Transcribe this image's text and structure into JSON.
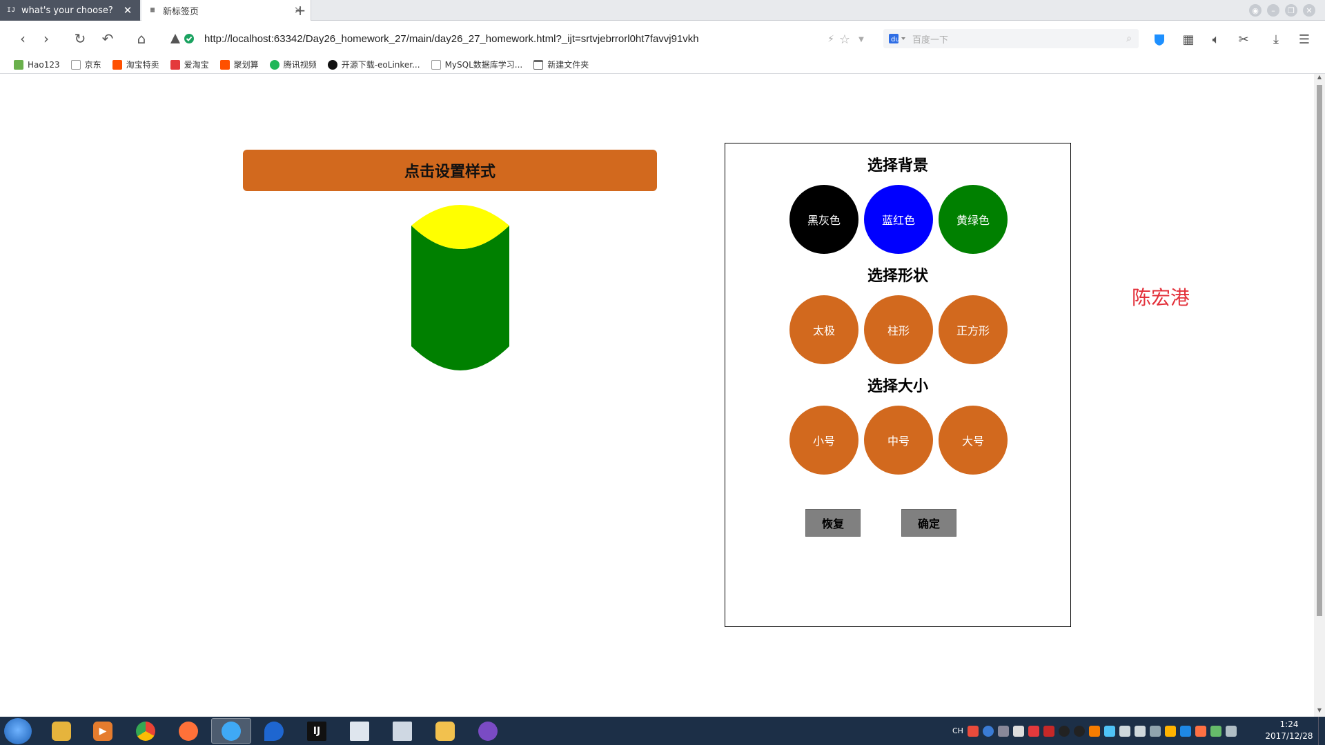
{
  "browser": {
    "tabs": [
      {
        "title": "what's your choose?",
        "favicon": "IJ",
        "active": true
      },
      {
        "title": "新标签页",
        "favicon": "▦",
        "active": false
      }
    ],
    "new_tab_label": "+",
    "url": "http://localhost:63342/Day26_homework_27/main/day26_27_homework.html?_ijt=srtvjebrrorl0ht7favvj91vkh",
    "search_placeholder": "百度一下",
    "bookmarks": [
      {
        "label": "Hao123",
        "icon": "hao123-icon",
        "color": "#6ab04c"
      },
      {
        "label": "京东",
        "icon": "page-icon",
        "color": "#999999"
      },
      {
        "label": "淘宝特卖",
        "icon": "taobao-icon",
        "color": "#ff5000"
      },
      {
        "label": "爱淘宝",
        "icon": "aitaobao-icon",
        "color": "#e4393c"
      },
      {
        "label": "聚划算",
        "icon": "juhuasuan-icon",
        "color": "#ff5000"
      },
      {
        "label": "腾讯视频",
        "icon": "tencent-video-icon",
        "color": "#20b759"
      },
      {
        "label": "开源下载-eoLinker...",
        "icon": "eolinker-icon",
        "color": "#111111"
      },
      {
        "label": "MySQL数据库学习...",
        "icon": "page-icon",
        "color": "#999999"
      },
      {
        "label": "新建文件夹",
        "icon": "folder-icon",
        "color": "#666666"
      }
    ]
  },
  "page": {
    "set_style_button": "点击设置样式",
    "shape_colors": {
      "top": "#ffff00",
      "body": "#008000"
    },
    "panel": {
      "background_title": "选择背景",
      "background_options": [
        {
          "label": "黑灰色",
          "color": "#000000"
        },
        {
          "label": "蓝红色",
          "color": "#0000ff"
        },
        {
          "label": "黄绿色",
          "color": "#008000"
        }
      ],
      "shape_title": "选择形状",
      "shape_options": [
        {
          "label": "太极",
          "color": "#d2691e"
        },
        {
          "label": "柱形",
          "color": "#d2691e"
        },
        {
          "label": "正方形",
          "color": "#d2691e"
        }
      ],
      "size_title": "选择大小",
      "size_options": [
        {
          "label": "小号",
          "color": "#d2691e"
        },
        {
          "label": "中号",
          "color": "#d2691e"
        },
        {
          "label": "大号",
          "color": "#d2691e"
        }
      ],
      "reset_button": "恢复",
      "confirm_button": "确定"
    },
    "author_name": "陈宏港",
    "accent_color": "#d2691e"
  },
  "taskbar": {
    "language": "CH",
    "clock_time": "1:24",
    "clock_date": "2017/12/28",
    "apps": [
      {
        "name": "explorer-icon",
        "color": "#e6b43c"
      },
      {
        "name": "media-player-icon",
        "color": "#e57c2e"
      },
      {
        "name": "chrome-icon",
        "color": "#4285f4"
      },
      {
        "name": "firefox-icon",
        "color": "#ff7139"
      },
      {
        "name": "browser-icon",
        "color": "#3fa9f5",
        "active": true
      },
      {
        "name": "maps-icon",
        "color": "#1e66d0"
      },
      {
        "name": "intellij-icon",
        "color": "#111111",
        "label": "IJ"
      },
      {
        "name": "notepad-icon",
        "color": "#dfe6ee"
      },
      {
        "name": "calculator-icon",
        "color": "#cfd8e3"
      },
      {
        "name": "graduation-icon",
        "color": "#f2c14e"
      },
      {
        "name": "cat-app-icon",
        "color": "#7a4bc4"
      }
    ]
  }
}
